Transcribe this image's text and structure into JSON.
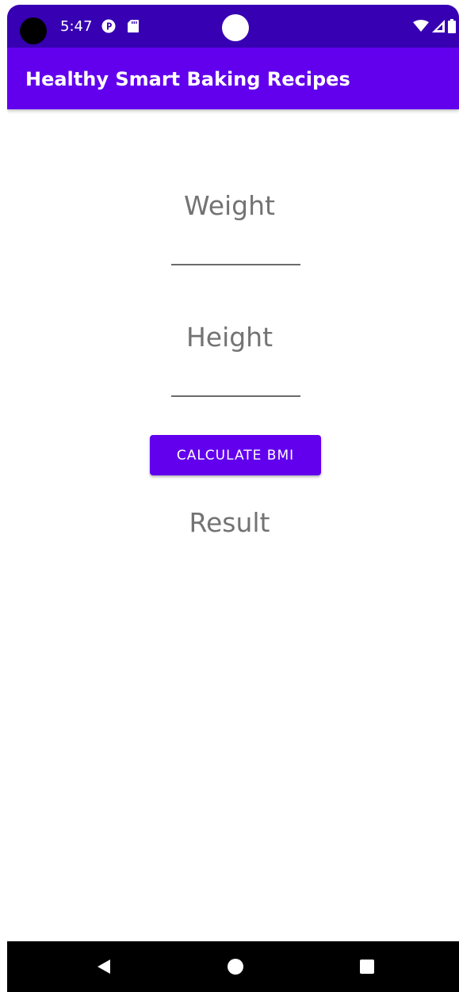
{
  "status_bar": {
    "time": "5:47",
    "icons": [
      "camera-hole-icon",
      "notification-app-icon",
      "sd-card-icon",
      "wifi-icon",
      "signal-icon",
      "battery-icon"
    ]
  },
  "app_bar": {
    "title": "Healthy Smart Baking Recipes"
  },
  "form": {
    "weight_label": "Weight",
    "weight_value": "",
    "height_label": "Height",
    "height_value": "",
    "calculate_label": "CALCULATE BMI",
    "result_label": "Result"
  },
  "nav_bar": {
    "icons": [
      "back-icon",
      "home-icon",
      "recents-icon"
    ]
  },
  "colors": {
    "status_bar": "#3700b3",
    "primary": "#6200ee",
    "label_text": "#737373",
    "background": "#ffffff",
    "nav_bar": "#000000"
  }
}
